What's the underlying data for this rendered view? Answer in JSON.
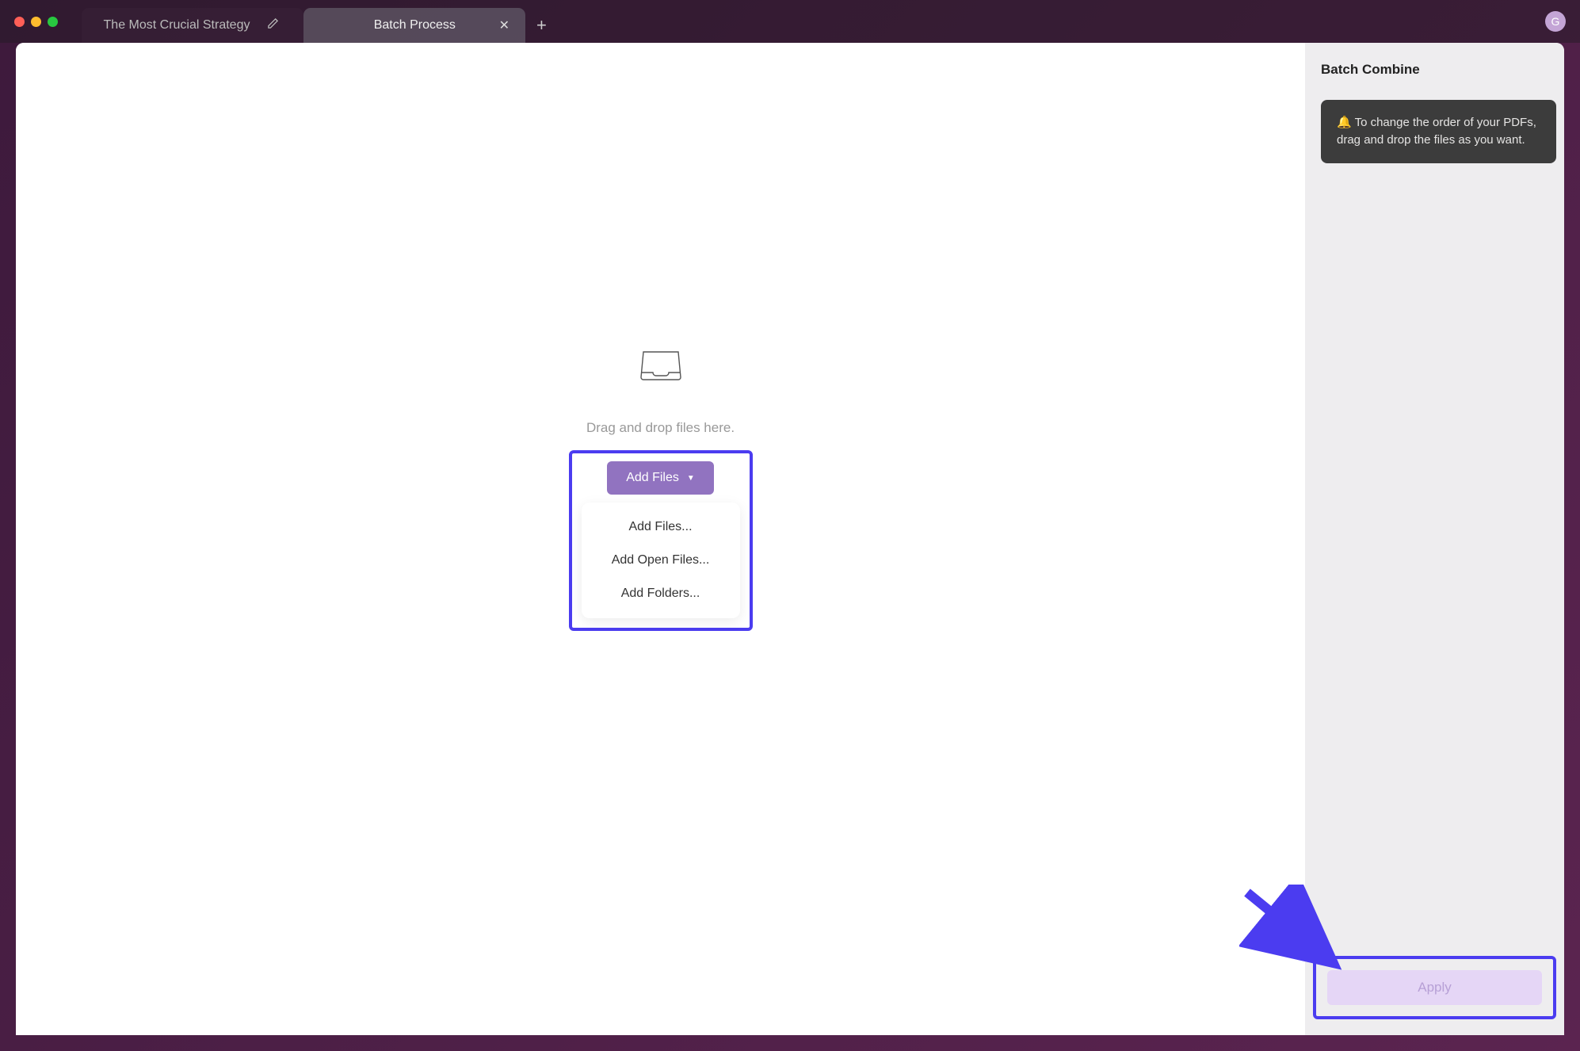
{
  "titlebar": {
    "tabs": [
      {
        "title": "The Most Crucial Strategy",
        "active": false
      },
      {
        "title": "Batch Process",
        "active": true
      }
    ],
    "avatar_initial": "G"
  },
  "main": {
    "drop_hint": "Drag and drop files here.",
    "add_files_button": "Add Files",
    "menu": {
      "add_files": "Add Files...",
      "add_open_files": "Add Open Files...",
      "add_folders": "Add Folders..."
    }
  },
  "sidebar": {
    "title": "Batch Combine",
    "tip": "🔔 To change the order of your PDFs, drag and drop the files as you want.",
    "apply_label": "Apply"
  }
}
